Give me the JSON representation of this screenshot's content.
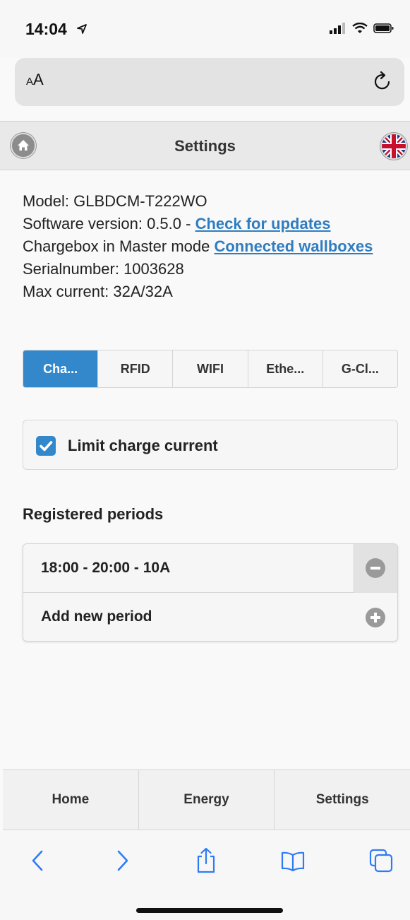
{
  "status_bar": {
    "time": "14:04"
  },
  "url_bar": {
    "aa_small": "A",
    "aa_large": "A"
  },
  "header": {
    "title": "Settings"
  },
  "info": {
    "model": "Model: GLBDCM-T222WO",
    "software_prefix": "Software version: 0.5.0 - ",
    "check_updates_link": "Check for updates",
    "mode_prefix": "Chargebox in Master mode ",
    "connected_link": "Connected wallboxes",
    "serial": "Serialnumber: 1003628",
    "max_current": "Max current: 32A/32A"
  },
  "tabs": [
    {
      "label": "Cha..."
    },
    {
      "label": "RFID"
    },
    {
      "label": "WIFI"
    },
    {
      "label": "Ethe..."
    },
    {
      "label": "G-Cl..."
    }
  ],
  "limit_charge": {
    "label": "Limit charge current",
    "checked": true
  },
  "periods": {
    "title": "Registered periods",
    "items": [
      {
        "text": "18:00 - 20:00 - 10A"
      }
    ],
    "add_label": "Add new period"
  },
  "bottom_nav": [
    {
      "label": "Home"
    },
    {
      "label": "Energy"
    },
    {
      "label": "Settings"
    }
  ],
  "colors": {
    "accent": "#3388cc",
    "link": "#2f7dc0",
    "safari_blue": "#2f7bf5"
  }
}
